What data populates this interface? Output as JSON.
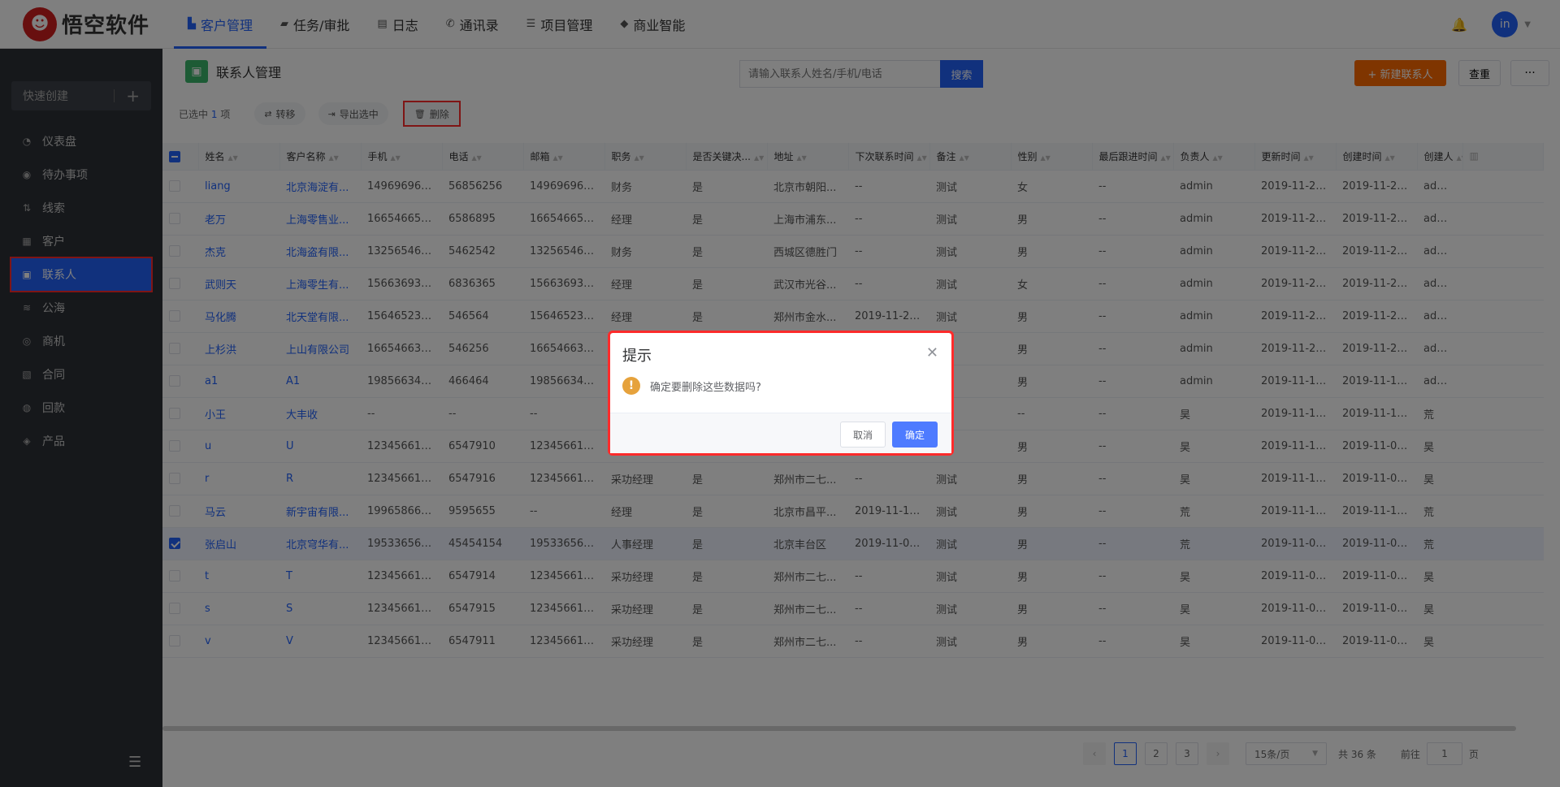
{
  "brand": {
    "name": "悟空软件",
    "logo_icon": "monkey-logo-icon"
  },
  "nav": [
    {
      "label": "客户管理",
      "icon": "customer-icon",
      "active": true
    },
    {
      "label": "任务/审批",
      "icon": "briefcase-icon",
      "active": false
    },
    {
      "label": "日志",
      "icon": "log-icon",
      "active": false
    },
    {
      "label": "通讯录",
      "icon": "phone-icon",
      "active": false
    },
    {
      "label": "项目管理",
      "icon": "list-icon",
      "active": false
    },
    {
      "label": "商业智能",
      "icon": "shield-icon",
      "active": false
    }
  ],
  "user": {
    "avatar_text": "in"
  },
  "sidebar": {
    "quick_create": "快速创建",
    "items": [
      {
        "label": "仪表盘",
        "icon": "dashboard-icon",
        "active": false
      },
      {
        "label": "待办事项",
        "icon": "chat-icon",
        "active": false
      },
      {
        "label": "线索",
        "icon": "leads-icon",
        "active": false
      },
      {
        "label": "客户",
        "icon": "building-icon",
        "active": false
      },
      {
        "label": "联系人",
        "icon": "contact-icon",
        "active": true
      },
      {
        "label": "公海",
        "icon": "sea-icon",
        "active": false
      },
      {
        "label": "商机",
        "icon": "coin-icon",
        "active": false
      },
      {
        "label": "合同",
        "icon": "contract-icon",
        "active": false
      },
      {
        "label": "回款",
        "icon": "money-bag-icon",
        "active": false
      },
      {
        "label": "产品",
        "icon": "box-icon",
        "active": false
      }
    ]
  },
  "page": {
    "title": "联系人管理",
    "search_placeholder": "请输入联系人姓名/手机/电话",
    "search_button": "搜索",
    "new_button": "+ 新建联系人",
    "reset_button": "查重",
    "more_button": "···"
  },
  "selection": {
    "prefix": "已选中",
    "count": "1",
    "suffix": "项",
    "transfer": "转移",
    "export": "导出选中",
    "delete": "删除"
  },
  "table": {
    "columns": [
      "姓名",
      "客户名称",
      "手机",
      "电话",
      "邮箱",
      "职务",
      "是否关键决...",
      "地址",
      "下次联系时间",
      "备注",
      "性别",
      "最后跟进时间",
      "负责人",
      "更新时间",
      "创建时间",
      "创建人"
    ],
    "rows": [
      {
        "checked": false,
        "cells": [
          "liang",
          "北京海淀有...",
          "149696969...",
          "56856256",
          "149696969...",
          "财务",
          "是",
          "北京市朝阳...",
          "--",
          "测试",
          "女",
          "--",
          "admin",
          "2019-11-20...",
          "2019-11-20...",
          "admin"
        ]
      },
      {
        "checked": false,
        "cells": [
          "老万",
          "上海零售业...",
          "166546655...",
          "6586895",
          "166546655...",
          "经理",
          "是",
          "上海市浦东...",
          "--",
          "测试",
          "男",
          "--",
          "admin",
          "2019-11-20...",
          "2019-11-20...",
          "admin"
        ]
      },
      {
        "checked": false,
        "cells": [
          "杰克",
          "北海盗有限...",
          "132565464...",
          "5462542",
          "132565464...",
          "财务",
          "是",
          "西城区德胜门",
          "--",
          "测试",
          "男",
          "--",
          "admin",
          "2019-11-20...",
          "2019-11-20...",
          "admin"
        ]
      },
      {
        "checked": false,
        "cells": [
          "武则天",
          "上海零生有...",
          "156636936...",
          "6836365",
          "156636936...",
          "经理",
          "是",
          "武汉市光谷...",
          "--",
          "测试",
          "女",
          "--",
          "admin",
          "2019-11-20...",
          "2019-11-20...",
          "admin"
        ]
      },
      {
        "checked": false,
        "cells": [
          "马化腾",
          "北天堂有限...",
          "156465234...",
          "546564",
          "156465234...",
          "经理",
          "是",
          "郑州市金水...",
          "2019-11-21...",
          "测试",
          "男",
          "--",
          "admin",
          "2019-11-20...",
          "2019-11-20...",
          "admin"
        ]
      },
      {
        "checked": false,
        "cells": [
          "上杉洪",
          "上山有限公司",
          "166546636...",
          "546256",
          "166546636...",
          "",
          "",
          "",
          "",
          "",
          "男",
          "--",
          "admin",
          "2019-11-20...",
          "2019-11-20...",
          "admin"
        ]
      },
      {
        "checked": false,
        "cells": [
          "a1",
          "A1",
          "198566345...",
          "466464",
          "198566345...",
          "",
          "",
          "",
          "",
          "",
          "男",
          "--",
          "admin",
          "2019-11-18...",
          "2019-11-18...",
          "admin"
        ]
      },
      {
        "checked": false,
        "cells": [
          "小王",
          "大丰收",
          "--",
          "--",
          "--",
          "",
          "",
          "",
          "",
          "",
          "--",
          "--",
          "昊",
          "2019-11-15...",
          "2019-11-15...",
          "荒"
        ]
      },
      {
        "checked": false,
        "cells": [
          "u",
          "U",
          "123456610...",
          "6547910",
          "123456610...",
          "",
          "",
          "",
          "",
          "",
          "男",
          "--",
          "昊",
          "2019-11-14...",
          "2019-11-09...",
          "昊"
        ]
      },
      {
        "checked": false,
        "cells": [
          "r",
          "R",
          "123456610...",
          "6547916",
          "123456610...",
          "采功经理",
          "是",
          "郑州市二七...",
          "--",
          "测试",
          "男",
          "--",
          "昊",
          "2019-11-14...",
          "2019-11-09...",
          "昊"
        ]
      },
      {
        "checked": false,
        "cells": [
          "马云",
          "新宇宙有限...",
          "199658666...",
          "9595655",
          "--",
          "经理",
          "是",
          "北京市昌平...",
          "2019-11-19...",
          "测试",
          "男",
          "--",
          "荒",
          "2019-11-11...",
          "2019-11-11...",
          "荒"
        ]
      },
      {
        "checked": true,
        "cells": [
          "张启山",
          "北京穹华有...",
          "195336566...",
          "45454154",
          "195336566...",
          "人事经理",
          "是",
          "北京丰台区",
          "2019-11-09...",
          "测试",
          "男",
          "--",
          "荒",
          "2019-11-09...",
          "2019-11-09...",
          "荒"
        ]
      },
      {
        "checked": false,
        "cells": [
          "t",
          "T",
          "123456610...",
          "6547914",
          "123456610...",
          "采功经理",
          "是",
          "郑州市二七...",
          "--",
          "测试",
          "男",
          "--",
          "昊",
          "2019-11-09...",
          "2019-11-09...",
          "昊"
        ]
      },
      {
        "checked": false,
        "cells": [
          "s",
          "S",
          "123456610...",
          "6547915",
          "123456610...",
          "采功经理",
          "是",
          "郑州市二七...",
          "--",
          "测试",
          "男",
          "--",
          "昊",
          "2019-11-09...",
          "2019-11-09...",
          "昊"
        ]
      },
      {
        "checked": false,
        "cells": [
          "v",
          "V",
          "123456610...",
          "6547911",
          "123456610...",
          "采功经理",
          "是",
          "郑州市二七...",
          "--",
          "测试",
          "男",
          "--",
          "昊",
          "2019-11-09...",
          "2019-11-09...",
          "昊"
        ]
      }
    ]
  },
  "pagination": {
    "pages": [
      "1",
      "2",
      "3"
    ],
    "current": "1",
    "page_size": "15条/页",
    "total": "共 36 条",
    "goto_prefix": "前往",
    "goto_value": "1",
    "goto_suffix": "页"
  },
  "dialog": {
    "title": "提示",
    "message": "确定要删除这些数据吗?",
    "cancel": "取消",
    "confirm": "确定",
    "icon": "warning-icon"
  },
  "colors": {
    "primary": "#2362fb",
    "orange": "#ff6a00",
    "warning": "#e6a23c",
    "highlight": "#ff2b2b"
  }
}
